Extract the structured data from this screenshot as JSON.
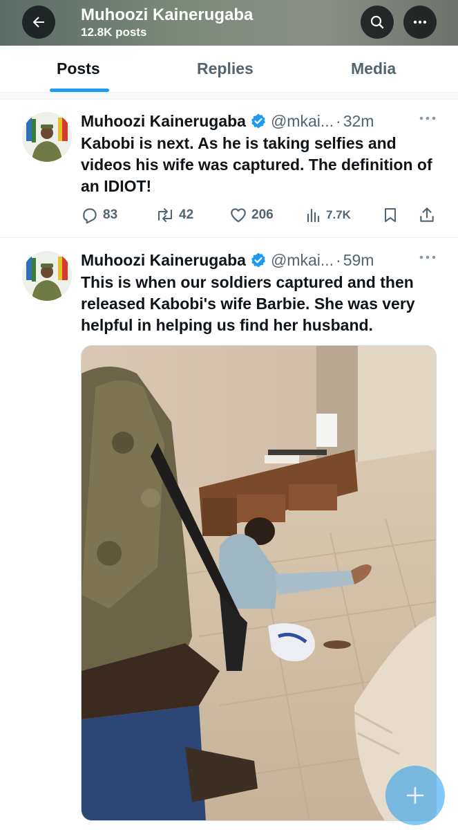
{
  "header": {
    "title": "Muhoozi Kainerugaba",
    "post_count": "12.8K posts"
  },
  "tabs": [
    {
      "label": "Posts",
      "active": true
    },
    {
      "label": "Replies",
      "active": false
    },
    {
      "label": "Media",
      "active": false
    }
  ],
  "tweets": [
    {
      "author": "Muhoozi Kainerugaba",
      "handle": "@mkai...",
      "separator": "·",
      "time": "32m",
      "text": "Kabobi is next. As he is taking selfies and videos his wife was captured. The definition of an IDIOT!",
      "replies": "83",
      "reposts": "42",
      "likes": "206",
      "views": "7.7K"
    },
    {
      "author": "Muhoozi Kainerugaba",
      "handle": "@mkai...",
      "separator": "·",
      "time": "59m",
      "text": "This is when our soldiers captured and then released Kabobi's wife Barbie. She was very helpful in helping us find her husband.",
      "has_photo": true
    }
  ],
  "colors": {
    "accent": "#1d9bf0",
    "text_primary": "#0f1419",
    "text_secondary": "#536471"
  },
  "icons": {
    "back": "arrow-left-icon",
    "search": "search-icon",
    "more": "more-horizontal-icon",
    "verified": "verified-badge-icon",
    "reply": "reply-icon",
    "repost": "repost-icon",
    "like": "heart-icon",
    "views": "views-icon",
    "bookmark": "bookmark-icon",
    "share": "share-icon",
    "compose": "plus-icon"
  }
}
